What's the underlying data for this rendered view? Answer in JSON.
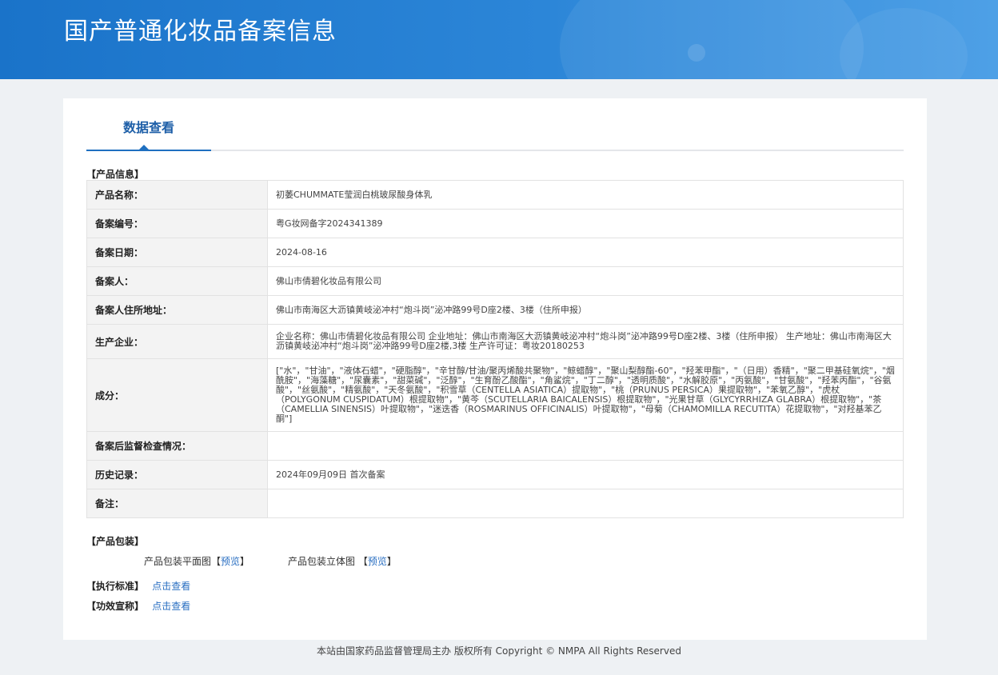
{
  "header": {
    "title": "国产普通化妆品备案信息"
  },
  "tabs": [
    {
      "label": "数据查看"
    }
  ],
  "sections": {
    "product_info": "【产品信息】",
    "packaging": "【产品包装】",
    "standard": "【执行标准】",
    "efficacy": "【功效宣称】"
  },
  "product_info": {
    "rows": [
      {
        "label": "产品名称：",
        "value": "初萎CHUMMATE莹润白桃玻尿酸身体乳"
      },
      {
        "label": "备案编号：",
        "value": "粤G妆网备字2024341389"
      },
      {
        "label": "备案日期：",
        "value": "2024-08-16"
      },
      {
        "label": "备案人：",
        "value": "佛山市倩碧化妆品有限公司"
      },
      {
        "label": "备案人住所地址：",
        "value": "佛山市南海区大沥镇黄岐泌冲村“炮斗岗”泌冲路99号D座2楼、3楼（住所申报）"
      },
      {
        "label": "生产企业：",
        "value": "企业名称：佛山市倩碧化妆品有限公司 企业地址：佛山市南海区大沥镇黄岐泌冲村“炮斗岗”泌冲路99号D座2楼、3楼（住所申报） 生产地址：佛山市南海区大沥镇黄岐泌冲村“炮斗岗”泌冲路99号D座2楼,3楼 生产许可证：粤妆20180253"
      },
      {
        "label": "成分：",
        "value": "[\"水\"，\"甘油\"，\"液体石蜡\"，\"硬脂醇\"，\"辛甘醇/甘油/聚丙烯酸共聚物\"，\"鲸蜡醇\"，\"聚山梨醇酯-60\"，\"羟苯甲酯\"，\"（日用）香精\"，\"聚二甲基硅氧烷\"，\"烟酰胺\"，\"海藻糖\"，\"尿囊素\"，\"甜菜碱\"，\"泛醇\"，\"生育酚乙酸酯\"，\"角鲨烷\"，\"丁二醇\"，\"透明质酸\"，\"水解胶原\"，\"丙氨酸\"，\"甘氨酸\"，\"羟苯丙酯\"，\"谷氨酸\"，\"丝氨酸\"，\"精氨酸\"，\"天冬氨酸\"，\"积雪草（CENTELLA ASIATICA）提取物\"，\"桃（PRUNUS PERSICA）果提取物\"，\"苯氧乙醇\"，\"虎杖（POLYGONUM CUSPIDATUM）根提取物\"，\"黄芩（SCUTELLARIA BAICALENSIS）根提取物\"，\"光果甘草（GLYCYRRHIZA GLABRA）根提取物\"，\"茶（CAMELLIA SINENSIS）叶提取物\"，\"迷迭香（ROSMARINUS OFFICINALIS）叶提取物\"，\"母菊（CHAMOMILLA RECUTITA）花提取物\"，\"对羟基苯乙酮\"]"
      },
      {
        "label": "备案后监督检查情况：",
        "value": ""
      },
      {
        "label": "历史记录：",
        "value": "2024年09月09日 首次备案"
      },
      {
        "label": "备注：",
        "value": ""
      }
    ]
  },
  "packaging": {
    "flat_label": "产品包装平面图",
    "solid_label": "产品包装立体图",
    "bracket_open": "【",
    "bracket_close": "】",
    "preview_label": "预览"
  },
  "links": {
    "standard": "点击查看",
    "efficacy": "点击查看"
  },
  "footer": {
    "text": "本站由国家药品监督管理局主办 版权所有 Copyright © NMPA All Rights Reserved"
  }
}
